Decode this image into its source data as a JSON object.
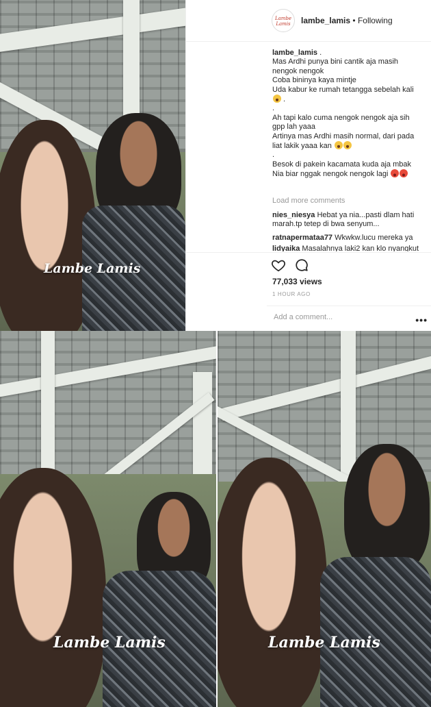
{
  "post": {
    "username": "lambe_lamis",
    "follow_status": "Following",
    "avatar_text": "Lambe Lamis",
    "caption_lines": [
      "Mas Ardhi punya bini cantik aja masih",
      "nengok nengok",
      "Coba bininya kaya mintje",
      "Uda kabur ke rumah tetangga sebelah kali",
      ".",
      "Ah tapi kalo cuma nengok nengok aja sih",
      "gpp lah yaaa",
      "Artinya mas Ardhi masih normal, dari pada",
      "liat lakik yaaa kan",
      ".",
      "Besok di pakein kacamata kuda aja mbak",
      "Nia biar nggak nengok nengok lagi"
    ],
    "load_more": "Load more comments",
    "comments": [
      {
        "user": "nies_niesya",
        "text": "Hebat ya nia...pasti dlam hati marah.tp tetep di bwa senyum..."
      },
      {
        "user": "ratnapermataa77",
        "text": "Wkwkw.lucu mereka ya"
      },
      {
        "user": "lidyaika",
        "text": "Masalahnya laki2 kan klo nyangkut"
      }
    ],
    "views": "77,033 views",
    "time_ago": "1 HOUR AGO",
    "add_comment_placeholder": "Add a comment...",
    "more_label": "•••"
  },
  "watermark": "Lambe Lamis",
  "icons": {
    "like": "heart-icon",
    "comment": "comment-icon",
    "more": "more-options-icon"
  },
  "colors": {
    "text": "#262626",
    "muted": "#999999",
    "border": "#efefef"
  }
}
